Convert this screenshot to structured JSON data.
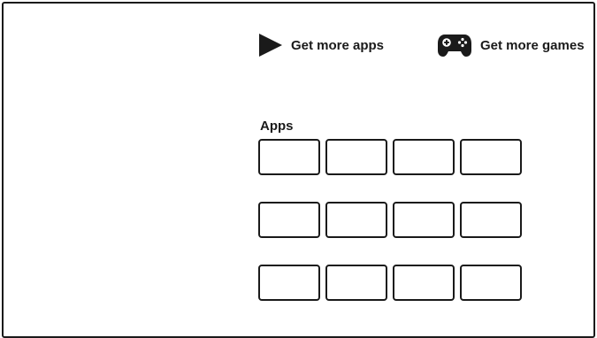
{
  "header": {
    "get_apps": {
      "label": "Get more apps",
      "icon": "play-triangle-icon"
    },
    "get_games": {
      "label": "Get more games",
      "icon": "gamepad-icon"
    }
  },
  "apps_section": {
    "title": "Apps",
    "tiles": [
      {
        "row": 1,
        "col": 1
      },
      {
        "row": 1,
        "col": 2
      },
      {
        "row": 1,
        "col": 3
      },
      {
        "row": 1,
        "col": 4
      },
      {
        "row": 2,
        "col": 1
      },
      {
        "row": 2,
        "col": 2
      },
      {
        "row": 2,
        "col": 3
      },
      {
        "row": 2,
        "col": 4
      },
      {
        "row": 3,
        "col": 1
      },
      {
        "row": 3,
        "col": 2
      },
      {
        "row": 3,
        "col": 3
      },
      {
        "row": 3,
        "col": 4
      }
    ]
  },
  "colors": {
    "ink": "#1a1a1a",
    "background": "#ffffff"
  }
}
